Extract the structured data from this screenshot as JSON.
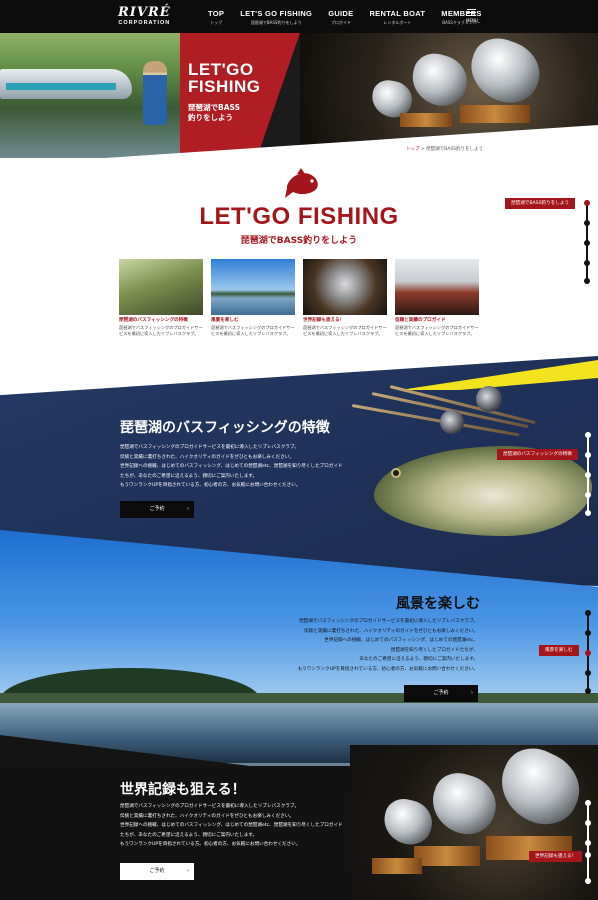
{
  "header": {
    "logo_main": "RIVRÉ",
    "logo_sub": "CORPORATION",
    "nav": [
      {
        "label": "TOP",
        "sub": "トップ"
      },
      {
        "label": "LET'S GO FISHING",
        "sub": "琵琶湖でBASS釣りをしよう"
      },
      {
        "label": "GUIDE",
        "sub": "プロガイド"
      },
      {
        "label": "RENTAL BOAT",
        "sub": "レンタルボート"
      },
      {
        "label": "MEMBERS",
        "sub": "BASSクラブメンバー"
      }
    ],
    "menu_label": "MENU"
  },
  "hero": {
    "title_line1": "LET'GO",
    "title_line2": "FISHING",
    "subtitle_line1": "琵琶湖でBASS",
    "subtitle_line2": "釣りをしよう"
  },
  "breadcrumb": {
    "home": "トップ",
    "separator": ">",
    "current": "琵琶湖でBASS釣りをしよう"
  },
  "intro": {
    "title": "LET'GO FISHING",
    "subtitle": "琵琶湖でBASS釣りをしよう"
  },
  "cards": [
    {
      "title": "琵琶湖のバスフィッシングの特徴",
      "text": "琵琶湖でバスフィッシングのプロガイドサービスを最初に導入したリブレバスクラブ。"
    },
    {
      "title": "風景を楽しむ",
      "text": "琵琶湖でバスフィッシングのプロガイドサービスを最初に導入したリブレバスクラブ。"
    },
    {
      "title": "世界記録も狙える！",
      "text": "琵琶湖でバスフィッシングのプロガイドサービスを最初に導入したリブレバスクラブ。"
    },
    {
      "title": "信頼と実績のプロガイド",
      "text": "琵琶湖でバスフィッシングのプロガイドサービスを最初に導入したリブレバスクラブ。"
    }
  ],
  "side_tags": {
    "intro": "琵琶湖でBASS釣りをしよう",
    "sec1": "琵琶湖のバスフィッシングの特徴",
    "sec2": "風景を楽しむ",
    "sec3": "世界記録も狙える！"
  },
  "sections": {
    "sec1": {
      "title": "琵琶湖のバスフィッシングの特徴",
      "lines": [
        "琵琶湖でバスフィッシングのプロガイドサービスを最初に導入したリブレバスクラブ。",
        "伝統と実績に裏打ちされた、ハイクオリティのガイドをぜひともお楽しみください。",
        "世界記録への挑戦、はじめてのバスフィッシング、はじめての琵琶湖etc、琵琶湖を知り尽くしたプロガイド",
        "たちが、あなたのご希望に沿えるよう、親切にご案内いたします。",
        "もうワンランクUPを目指されている方、初心者の方、お気軽にお問い合わせください。"
      ],
      "button": "ご予約"
    },
    "sec2": {
      "title": "風景を楽しむ",
      "lines": [
        "琵琶湖でバスフィッシングのプロガイドサービスを最初に導入したリブレバスクラブ。",
        "伝統と実績に裏打ちされた、ハイクオリティのガイドをぜひともお楽しみください。",
        "世界記録への挑戦、はじめてのバスフィッシング、はじめての琵琶湖etc、",
        "琵琶湖を知り尽くしたプロガイドたちが、",
        "あなたのご希望に沿えるよう、親切にご案内いたします。",
        "もうワンランクUPを目指されている方、初心者の方、お気軽にお問い合わせください。"
      ],
      "button": "ご予約"
    },
    "sec3": {
      "title": "世界記録も狙える！",
      "lines": [
        "琵琶湖でバスフィッシングのプロガイドサービスを最初に導入したリブレバスクラブ。",
        "伝統と実績に裏打ちされた、ハイクオリティのガイドをぜひともお楽しみください。",
        "世界記録への挑戦、はじめてのバスフィッシング、はじめての琵琶湖etc、琵琶湖を知り尽くしたプロガイド",
        "たちが、あなたのご希望に沿えるよう、親切にご案内いたします。",
        "もうワンランクUPを目指されている方、初心者の方、お気軽にお問い合わせください。"
      ],
      "button": "ご予約"
    }
  },
  "colors": {
    "brand_red": "#a5161c",
    "header_bg": "#0c0c0c",
    "accent_yellow": "#f3e21e",
    "navy": "#233a64"
  },
  "icons": {
    "menu": "hamburger-icon",
    "button_arrow": "chevron-right-icon",
    "intro_logo": "bass-fish-icon"
  }
}
